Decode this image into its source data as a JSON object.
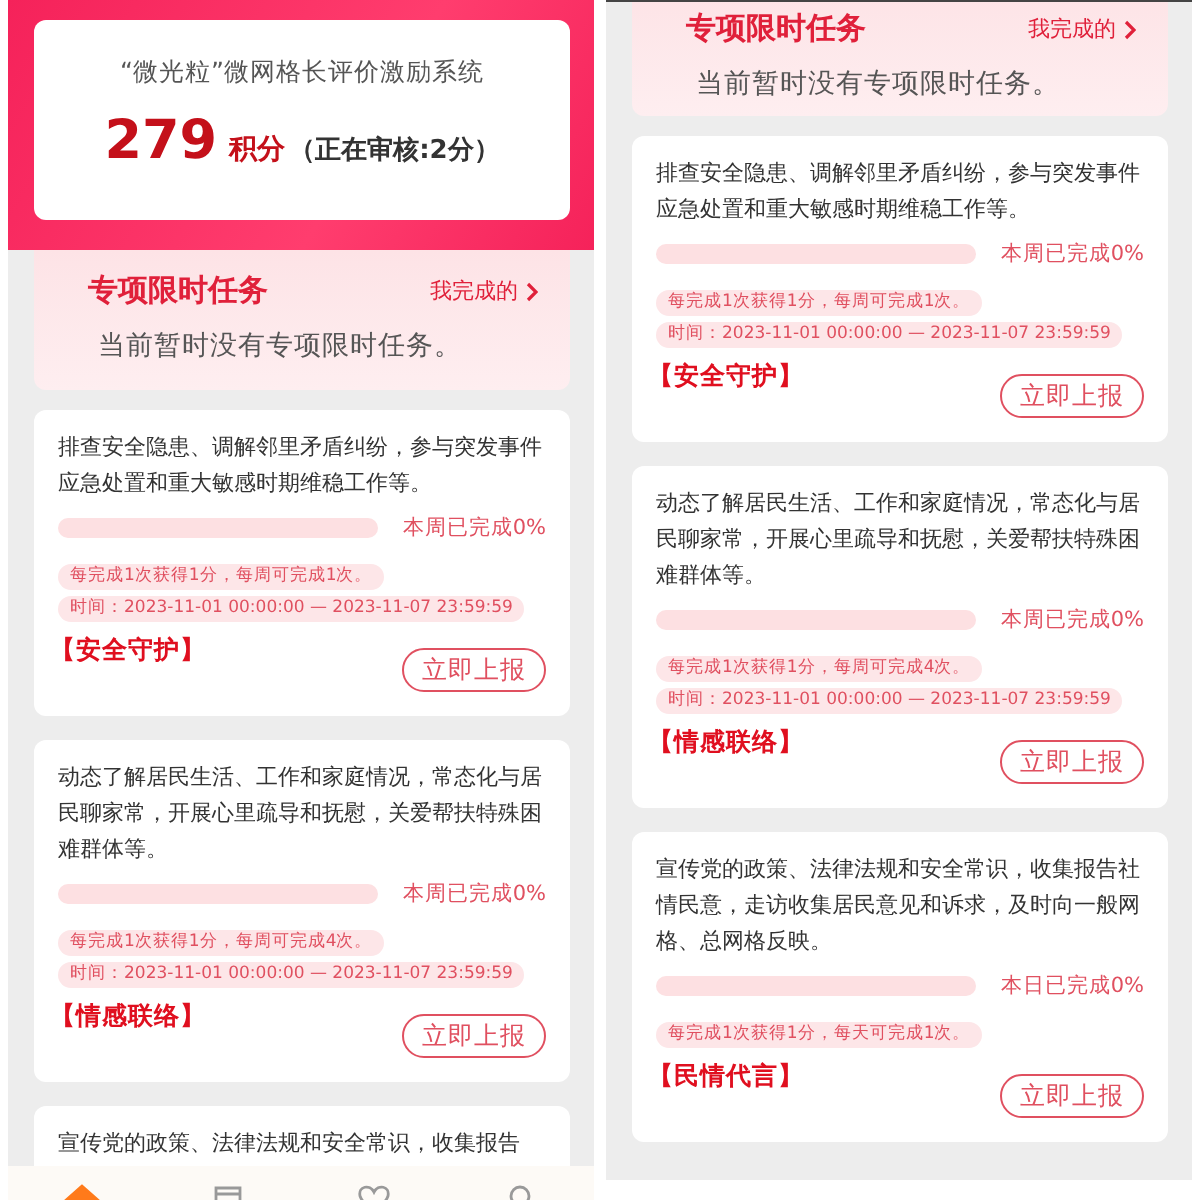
{
  "panels": [
    {
      "header": {
        "title": "“微光粒”微网格长评价激励系统",
        "points": "279",
        "points_unit": "积分",
        "pending": "（正在审核:2分）"
      },
      "special": {
        "title": "专项限时任务",
        "link": "我完成的",
        "empty": "当前暂时没有专项限时任务。"
      },
      "tasks": [
        {
          "description": "排查安全隐患、调解邻里矛盾纠纷，参与突发事件应急处置和重大敏感时期维稳工作等。",
          "level": 0,
          "progress_label": "本周已完成0%",
          "notes": [
            "每完成1次获得1分，每周可完成1次。",
            "时间：2023-11-01 00:00:00 — 2023-11-07 23:59:59"
          ],
          "category": "【安全守护】",
          "button": "立即上报"
        },
        {
          "description": "动态了解居民生活、工作和家庭情况，常态化与居民聊家常，开展心里疏导和抚慰，关爱帮扶特殊困难群体等。",
          "level": 0,
          "progress_label": "本周已完成0%",
          "notes": [
            "每完成1次获得1分，每周可完成4次。",
            "时间：2023-11-01 00:00:00 — 2023-11-07 23:59:59"
          ],
          "category": "【情感联络】",
          "button": "立即上报"
        },
        {
          "description": "宣传党的政策、法律法规和安全常识，收集报告"
        }
      ],
      "tab_bar": [
        {
          "kind": "home",
          "selected": true
        },
        {
          "kind": "document",
          "selected": false
        },
        {
          "kind": "heart",
          "selected": false
        },
        {
          "kind": "person",
          "selected": false
        }
      ]
    },
    {
      "special": {
        "title": "专项限时任务",
        "link": "我完成的",
        "empty": "当前暂时没有专项限时任务。"
      },
      "tasks": [
        {
          "description": "排查安全隐患、调解邻里矛盾纠纷，参与突发事件应急处置和重大敏感时期维稳工作等。",
          "level": 0,
          "progress_label": "本周已完成0%",
          "notes": [
            "每完成1次获得1分，每周可完成1次。",
            "时间：2023-11-01 00:00:00 — 2023-11-07 23:59:59"
          ],
          "category": "【安全守护】",
          "button": "立即上报"
        },
        {
          "description": "动态了解居民生活、工作和家庭情况，常态化与居民聊家常，开展心里疏导和抚慰，关爱帮扶特殊困难群体等。",
          "level": 0,
          "progress_label": "本周已完成0%",
          "notes": [
            "每完成1次获得1分，每周可完成4次。",
            "时间：2023-11-01 00:00:00 — 2023-11-07 23:59:59"
          ],
          "category": "【情感联络】",
          "button": "立即上报"
        },
        {
          "description": "宣传党的政策、法律法规和安全常识，收集报告社情民意，走访收集居民意见和诉求，及时向一般网格、总网格反映。",
          "level": 0,
          "progress_label": "本日已完成0%",
          "notes": [
            "每完成1次获得1分，每天可完成1次。"
          ],
          "category": "【民情代言】",
          "button": "立即上报"
        }
      ]
    }
  ]
}
